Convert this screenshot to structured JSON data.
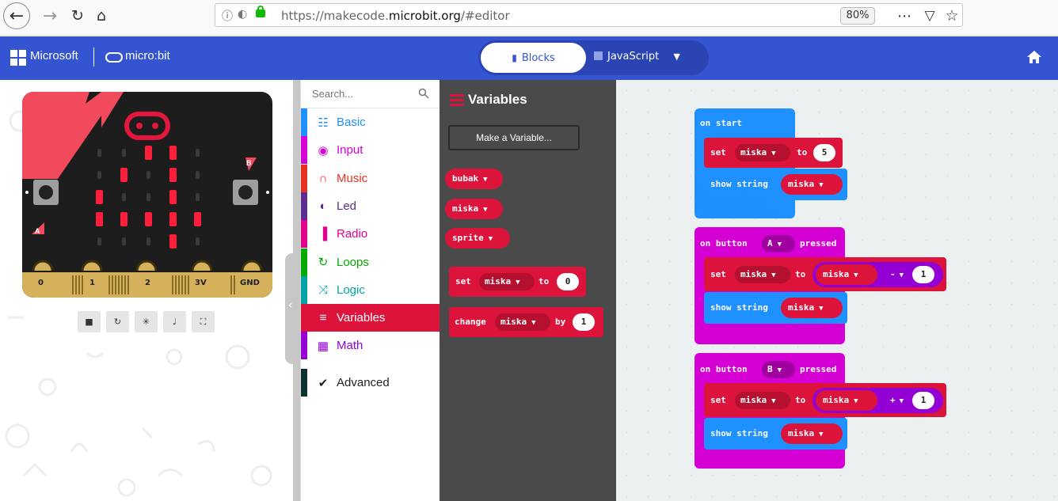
{
  "browser": {
    "url_prefix": "https://makecode.",
    "url_domain": "microbit.org",
    "url_suffix": "/#editor",
    "zoom": "80%"
  },
  "header": {
    "microsoft_label": "Microsoft",
    "microbit_label": "micro:bit",
    "tab_blocks": "Blocks",
    "tab_javascript": "JavaScript"
  },
  "simulator": {
    "pins": [
      "0",
      "1",
      "2",
      "3V",
      "GND"
    ],
    "button_a": "A",
    "button_b": "B",
    "led_grid": [
      [
        0,
        0,
        1,
        1,
        0
      ],
      [
        0,
        1,
        0,
        1,
        0
      ],
      [
        1,
        0,
        0,
        1,
        0
      ],
      [
        1,
        1,
        1,
        1,
        1
      ],
      [
        0,
        0,
        0,
        1,
        0
      ]
    ]
  },
  "toolbox": {
    "search_placeholder": "Search...",
    "categories": [
      {
        "label": "Basic",
        "color": "#1e90ff",
        "icon": "grid-icon"
      },
      {
        "label": "Input",
        "color": "#d400d4",
        "icon": "target-icon"
      },
      {
        "label": "Music",
        "color": "#e63022",
        "icon": "headphones-icon"
      },
      {
        "label": "Led",
        "color": "#5c2d91",
        "icon": "toggle-icon"
      },
      {
        "label": "Radio",
        "color": "#e3008c",
        "icon": "signal-icon"
      },
      {
        "label": "Loops",
        "color": "#00aa00",
        "icon": "loop-icon"
      },
      {
        "label": "Logic",
        "color": "#00a4a6",
        "icon": "shuffle-icon"
      },
      {
        "label": "Variables",
        "color": "#dc143c",
        "icon": "list-icon"
      },
      {
        "label": "Math",
        "color": "#9400d3",
        "icon": "calculator-icon"
      }
    ],
    "advanced": "Advanced"
  },
  "flyout": {
    "title": "Variables",
    "make_variable": "Make a Variable...",
    "variables": [
      "bubak",
      "miska",
      "sprite"
    ],
    "set_block": {
      "kw1": "set",
      "var": "miska",
      "kw2": "to",
      "value": "0"
    },
    "change_block": {
      "kw1": "change",
      "var": "miska",
      "kw2": "by",
      "value": "1"
    }
  },
  "workspace": {
    "on_start": {
      "label": "on start",
      "set_kw": "set",
      "set_var": "miska",
      "set_to": "to",
      "set_val": "5",
      "show_kw": "show string",
      "show_var": "miska"
    },
    "on_a": {
      "label_pre": "on button",
      "button": "A",
      "label_post": "pressed",
      "set_kw": "set",
      "set_var": "miska",
      "set_to": "to",
      "op_var": "miska",
      "op": "-",
      "op_val": "1",
      "show_kw": "show string",
      "show_var": "miska"
    },
    "on_b": {
      "label_pre": "on button",
      "button": "B",
      "label_post": "pressed",
      "set_kw": "set",
      "set_var": "miska",
      "set_to": "to",
      "op_var": "miska",
      "op": "+",
      "op_val": "1",
      "show_kw": "show string",
      "show_var": "miska"
    }
  },
  "colors": {
    "header": "#3454d1",
    "variables": "#dc143c",
    "basic": "#1e90ff",
    "input": "#d400d4",
    "math": "#9400d3"
  }
}
